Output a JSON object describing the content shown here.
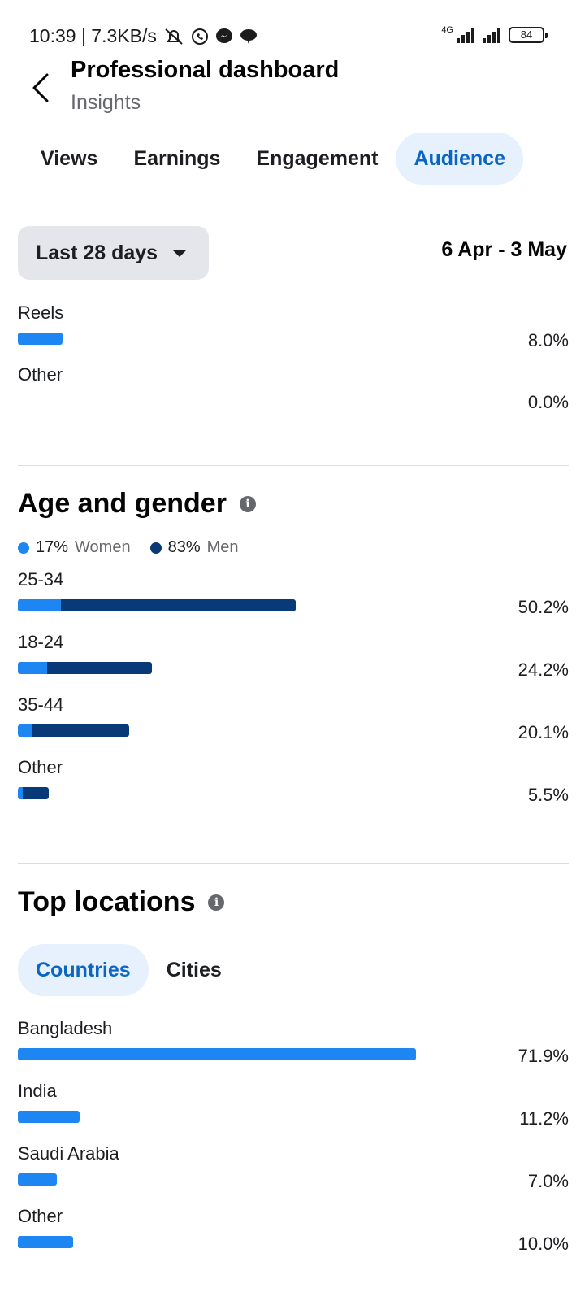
{
  "status": {
    "time_speed": "10:39 | 7.3KB/s",
    "network": "4G",
    "battery": "84"
  },
  "header": {
    "title": "Professional dashboard",
    "subtitle": "Insights"
  },
  "tabs": [
    {
      "label": "Views"
    },
    {
      "label": "Earnings"
    },
    {
      "label": "Engagement"
    },
    {
      "label": "Audience"
    }
  ],
  "date": {
    "range_label": "Last 28 days",
    "range_text": "6 Apr - 3 May"
  },
  "content_types": [
    {
      "label": "Reels",
      "value": "8.0%",
      "fraction": 0.08
    },
    {
      "label": "Other",
      "value": "0.0%",
      "fraction": 0.0
    }
  ],
  "age_gender": {
    "title": "Age and gender",
    "women_pct": "17%",
    "women_label": "Women",
    "men_pct": "83%",
    "men_label": "Men",
    "colors": {
      "women": "#1d86f2",
      "men": "#073a77"
    },
    "rows": [
      {
        "label": "25-34",
        "value": "50.2%",
        "fraction": 0.502,
        "women_share": 0.155
      },
      {
        "label": "18-24",
        "value": "24.2%",
        "fraction": 0.242,
        "women_share": 0.22
      },
      {
        "label": "35-44",
        "value": "20.1%",
        "fraction": 0.201,
        "women_share": 0.13
      },
      {
        "label": "Other",
        "value": "5.5%",
        "fraction": 0.055,
        "women_share": 0.17
      }
    ]
  },
  "locations": {
    "title": "Top locations",
    "tabs": [
      {
        "label": "Countries"
      },
      {
        "label": "Cities"
      }
    ],
    "rows": [
      {
        "label": "Bangladesh",
        "value": "71.9%",
        "fraction": 0.719
      },
      {
        "label": "India",
        "value": "11.2%",
        "fraction": 0.112
      },
      {
        "label": "Saudi Arabia",
        "value": "7.0%",
        "fraction": 0.07
      },
      {
        "label": "Other",
        "value": "10.0%",
        "fraction": 0.1
      }
    ]
  }
}
